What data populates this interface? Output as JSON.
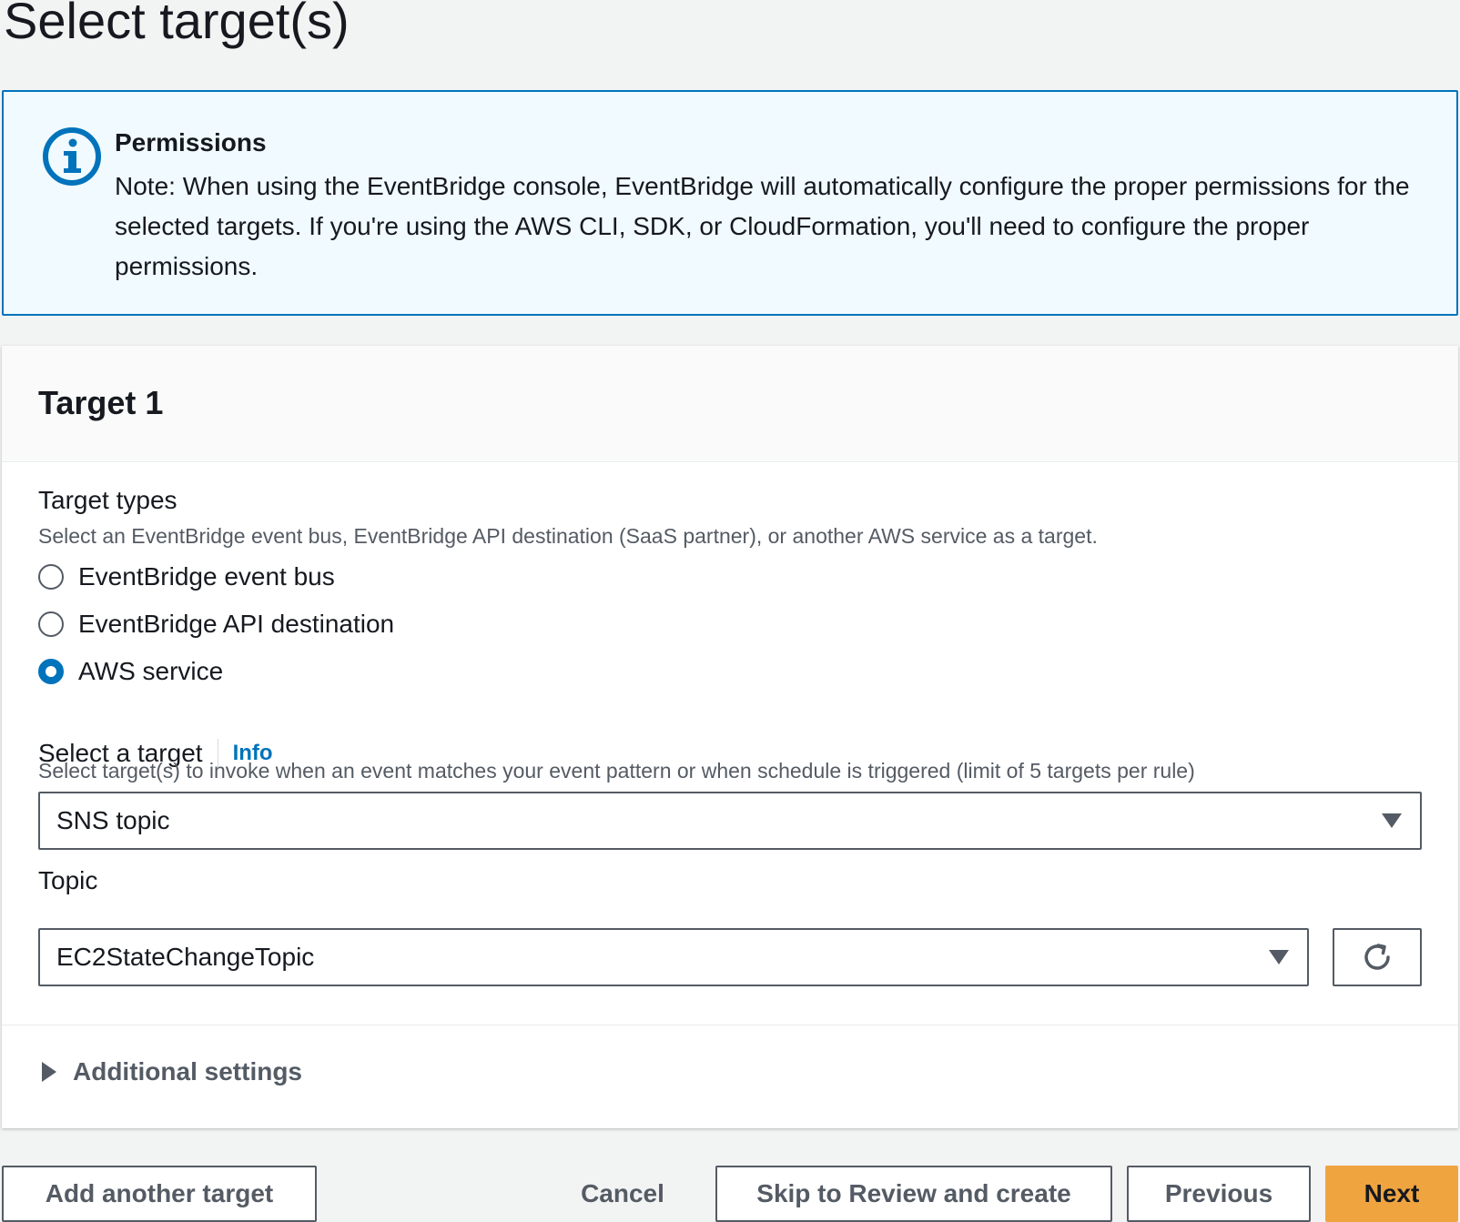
{
  "page": {
    "title": "Select target(s)"
  },
  "alert": {
    "icon": "info-icon",
    "title": "Permissions",
    "body": "Note: When using the EventBridge console, EventBridge will automatically configure the proper permissions for the selected targets. If you're using the AWS CLI, SDK, or CloudFormation, you'll need to configure the proper permissions."
  },
  "target": {
    "title": "Target 1",
    "types": {
      "label": "Target types",
      "description": "Select an EventBridge event bus, EventBridge API destination (SaaS partner), or another AWS service as a target.",
      "options": [
        {
          "label": "EventBridge event bus",
          "checked": false
        },
        {
          "label": "EventBridge API destination",
          "checked": false
        },
        {
          "label": "AWS service",
          "checked": true
        }
      ]
    },
    "select_target": {
      "label": "Select a target",
      "info_link": "Info",
      "description": "Select target(s) to invoke when an event matches your event pattern or when schedule is triggered (limit of 5 targets per rule)",
      "value": "SNS topic"
    },
    "topic": {
      "label": "Topic",
      "value": "EC2StateChangeTopic",
      "refresh_icon": "refresh-icon"
    },
    "additional_settings": {
      "label": "Additional settings",
      "expanded": false
    }
  },
  "footer": {
    "add_target": "Add another target",
    "cancel": "Cancel",
    "skip": "Skip to Review and create",
    "previous": "Previous",
    "next": "Next"
  },
  "colors": {
    "accent": "#0073bb",
    "primary_button": "#f0a440",
    "alert_background": "#f1faff"
  }
}
